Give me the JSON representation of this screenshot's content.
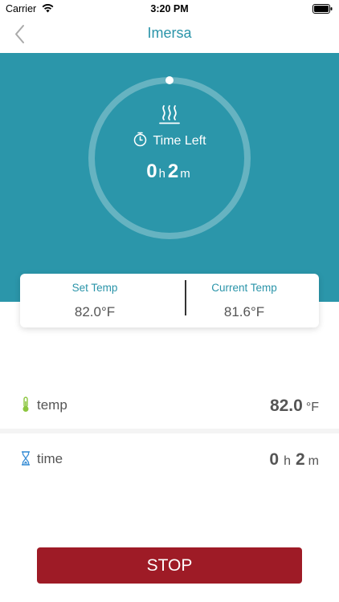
{
  "status_bar": {
    "carrier": "Carrier",
    "time": "3:20 PM"
  },
  "nav": {
    "title": "Imersa",
    "back_icon": "chevron-left-icon"
  },
  "timer": {
    "label": "Time Left",
    "hours": "0",
    "hours_unit": "h",
    "minutes": "2",
    "minutes_unit": "m",
    "heat_icon": "heat-waves-icon",
    "stopwatch_icon": "stopwatch-icon"
  },
  "temp_card": {
    "set_label": "Set Temp",
    "set_value": "82.0°F",
    "current_label": "Current Temp",
    "current_value": "81.6°F"
  },
  "settings": {
    "temp": {
      "label": "temp",
      "value": "82.0",
      "unit": "°F",
      "icon": "thermometer-icon"
    },
    "time": {
      "label": "time",
      "hours": "0",
      "hours_unit": "h",
      "minutes": "2",
      "minutes_unit": "m",
      "icon": "hourglass-icon"
    }
  },
  "actions": {
    "stop_label": "STOP"
  },
  "colors": {
    "accent": "#2b96aa",
    "stop": "#9e1b26",
    "thermometer": "#8cc63f",
    "hourglass": "#3b8fd6"
  }
}
